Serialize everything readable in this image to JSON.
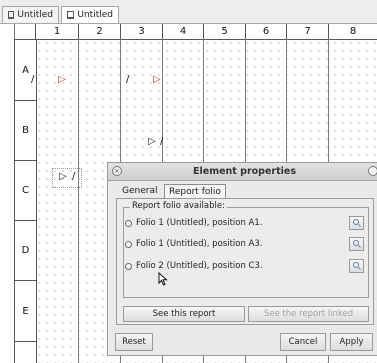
{
  "tabs": [
    {
      "label": "Untitled",
      "active": false
    },
    {
      "label": "Untitled",
      "active": true
    }
  ],
  "schematic": {
    "columns": [
      "1",
      "2",
      "3",
      "4",
      "5",
      "6",
      "7",
      "8"
    ],
    "rows": [
      "A",
      "B",
      "C",
      "D",
      "E"
    ],
    "symbol_glyph": "▷",
    "slash_glyph": "/"
  },
  "dialog": {
    "title": "Element properties",
    "close_glyph": "×",
    "tabs": [
      "General",
      "Report folio"
    ],
    "group_title": "Report folio available:",
    "folios": [
      "Folio  1 (Untitled), position A1.",
      "Folio  1 (Untitled), position A3.",
      "Folio  2 (Untitled), position C3."
    ],
    "see_report_label": "See this report",
    "see_linked_label": "See the report linked",
    "reset_label": "Reset",
    "cancel_label": "Cancel",
    "apply_label": "Apply"
  },
  "colors": {
    "accent_symbol": "#cc3333",
    "dialog_bg": "#eaeaea"
  },
  "icons": {
    "tab_icon": "window-icon",
    "goto_icon": "magnifier-icon",
    "close_icon": "close-icon"
  }
}
